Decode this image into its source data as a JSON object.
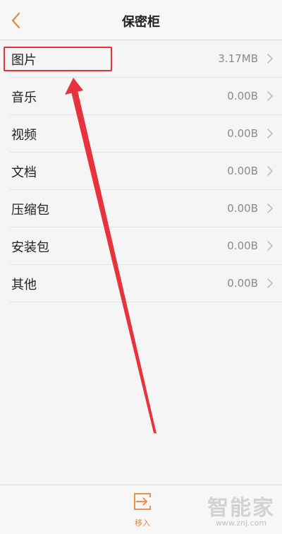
{
  "header": {
    "title": "保密柜",
    "back_icon": "chevron-left-icon"
  },
  "items": [
    {
      "label": "图片",
      "size": "3.17MB"
    },
    {
      "label": "音乐",
      "size": "0.00B"
    },
    {
      "label": "视频",
      "size": "0.00B"
    },
    {
      "label": "文档",
      "size": "0.00B"
    },
    {
      "label": "压缩包",
      "size": "0.00B"
    },
    {
      "label": "安装包",
      "size": "0.00B"
    },
    {
      "label": "其他",
      "size": "0.00B"
    }
  ],
  "bottom": {
    "move_in_label": "移入",
    "move_in_icon": "move-in-icon"
  },
  "watermark": {
    "main": "智能家",
    "sub": "www.znj.com"
  },
  "colors": {
    "accent": "#e7893e",
    "annotation": "#e0323c",
    "background": "#f5f5f5"
  }
}
